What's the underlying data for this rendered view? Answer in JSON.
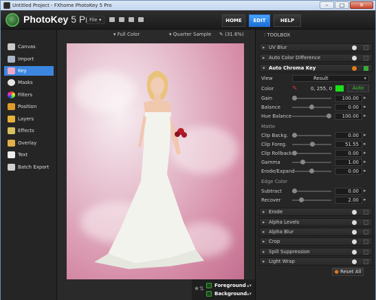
{
  "window": {
    "title": "Untitled Project - FXhome PhotoKey 5 Pro",
    "controls": {
      "minimize": "–",
      "maximize": "□",
      "close": "✕"
    }
  },
  "header": {
    "brand": "PhotoKey",
    "version": "5 Pro",
    "file_menu": "File",
    "nav": [
      {
        "label": "HOME"
      },
      {
        "label": "EDIT"
      },
      {
        "label": "HELP"
      }
    ]
  },
  "sidebar": {
    "items": [
      {
        "label": "Canvas",
        "icon": "canvas-icon"
      },
      {
        "label": "Import",
        "icon": "import-icon"
      },
      {
        "label": "Key",
        "icon": "key-icon"
      },
      {
        "label": "Masks",
        "icon": "masks-icon"
      },
      {
        "label": "Filters",
        "icon": "filters-icon"
      },
      {
        "label": "Position",
        "icon": "position-icon"
      },
      {
        "label": "Layers",
        "icon": "layers-icon"
      },
      {
        "label": "Effects",
        "icon": "effects-icon"
      },
      {
        "label": "Overlay",
        "icon": "overlay-icon"
      },
      {
        "label": "Text",
        "icon": "text-icon"
      },
      {
        "label": "Batch Export",
        "icon": "batch-export-icon"
      }
    ],
    "active": "Key"
  },
  "canvas_toolbar": {
    "color_mode": "Full Color",
    "sample": "Quarter Sample",
    "zoom": "(31.6%)"
  },
  "layers": [
    {
      "label": "Foreground",
      "checked": true
    },
    {
      "label": "Background",
      "checked": true
    }
  ],
  "toolbox": {
    "title": "TOOLBOX",
    "panels_top": [
      "UV Blur",
      "Auto Color Difference"
    ],
    "chroma": {
      "title": "Auto Chroma Key",
      "view_label": "View",
      "view_value": "Result",
      "color_label": "Color",
      "color_value": "0, 255, 0",
      "color_swatch": "#19e019",
      "auto_button": "Auto",
      "rows_main": [
        {
          "label": "Gain",
          "value": "100.00",
          "level": 0.0
        },
        {
          "label": "Balance",
          "value": "0.00",
          "level": 0.5
        },
        {
          "label": "Hue Balance",
          "value": "100.00",
          "level": 1.0
        }
      ],
      "matte_title": "Matte",
      "rows_matte": [
        {
          "label": "Clip Backg.",
          "value": "0.00",
          "level": 0.0
        },
        {
          "label": "Clip Foreg.",
          "value": "51.55",
          "level": 0.52
        },
        {
          "label": "Clip Rollback",
          "value": "0.00",
          "level": 0.0
        },
        {
          "label": "Gamma",
          "value": "1.00",
          "level": 0.25
        },
        {
          "label": "Erode/Expand",
          "value": "0.00",
          "level": 0.5
        }
      ],
      "edge_title": "Edge Color",
      "rows_edge": [
        {
          "label": "Subtract",
          "value": "0.00",
          "level": 0.0
        },
        {
          "label": "Recover",
          "value": "2.00",
          "level": 0.2
        }
      ]
    },
    "panels_bottom": [
      "Erode",
      "Alpha Levels",
      "Alpha Blur",
      "Crop",
      "Spill Suppression",
      "Light Wrap"
    ],
    "reset_label": "Reset All"
  },
  "colors": {
    "accent": "#2f7fe0",
    "chroma_on": "#e07a1a",
    "check": "#3aa93a"
  }
}
